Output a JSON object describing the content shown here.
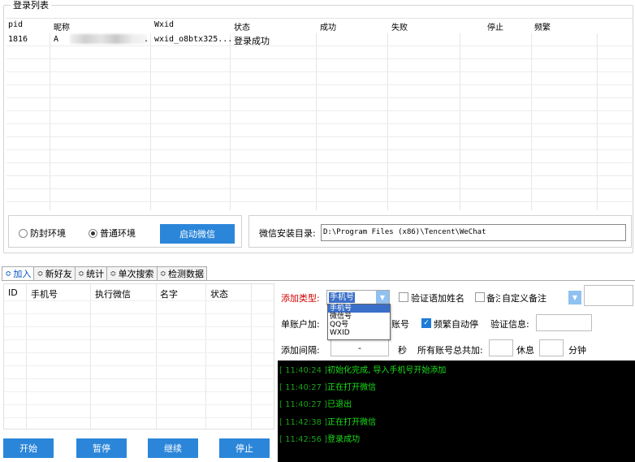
{
  "login_list": {
    "title": "登录列表",
    "columns": [
      "pid",
      "昵称",
      "Wxid",
      "状态",
      "成功",
      "失败",
      "停止",
      "频繁"
    ],
    "rows": [
      {
        "pid": "1816",
        "nickname": "A",
        "nickname_tail": ".",
        "wxid": "wxid_o8btx325...",
        "status": "登录成功",
        "success": "",
        "fail": "",
        "stop": "",
        "frequent": ""
      }
    ]
  },
  "env": {
    "anti_ban_label": "防封环境",
    "normal_label": "普通环境",
    "selected": "normal",
    "start_wechat_label": "启动微信"
  },
  "install": {
    "label": "微信安装目录:",
    "path": "D:\\Program Files (x86)\\Tencent\\WeChat"
  },
  "tabs": [
    {
      "label": "加入",
      "active": true
    },
    {
      "label": "新好友",
      "active": false
    },
    {
      "label": "统计",
      "active": false
    },
    {
      "label": "单次搜索",
      "active": false
    },
    {
      "label": "检测数据",
      "active": false
    }
  ],
  "add_table": {
    "columns": [
      "ID",
      "手机号",
      "执行微信",
      "名字",
      "状态"
    ]
  },
  "buttons": {
    "start": "开始",
    "pause": "暂停",
    "resume": "继续",
    "stop": "停止"
  },
  "add_panel": {
    "add_type_label": "添加类型:",
    "add_type_value": "手机号",
    "add_type_options": [
      "手机号",
      "微信号",
      "QQ号",
      "WXID"
    ],
    "verify_name_label": "验证语加姓名",
    "verify_name_checked": false,
    "remark_label": "备注",
    "remark_checked": false,
    "remark_mode_value": "自定义备注",
    "single_account_label": "单账户加:",
    "account_suffix": "账号",
    "auto_stop_label": "频繁自动停",
    "auto_stop_checked": true,
    "verify_info_label": "验证信息:",
    "interval_label": "添加间隔:",
    "interval_value": "-",
    "seconds_label": "秒",
    "total_label": "所有账号总共加:",
    "rest_label": "休息",
    "minutes_label": "分钟"
  },
  "log": [
    {
      "time": "[ 11:40:24 ]",
      "text": "初始化完成, 导入手机号开始添加"
    },
    {
      "time": "[ 11:40:27 ]",
      "text": "正在打开微信"
    },
    {
      "time": "[ 11:40:27 ]",
      "text": "已退出"
    },
    {
      "time": "[ 11:42:38 ]",
      "text": "正在打开微信"
    },
    {
      "time": "[ 11:42:56 ]",
      "text": "登录成功"
    }
  ],
  "colors": {
    "accent": "#2b86d9",
    "log_bg": "#000000",
    "log_text": "#18e018",
    "label_red": "#d00000"
  }
}
